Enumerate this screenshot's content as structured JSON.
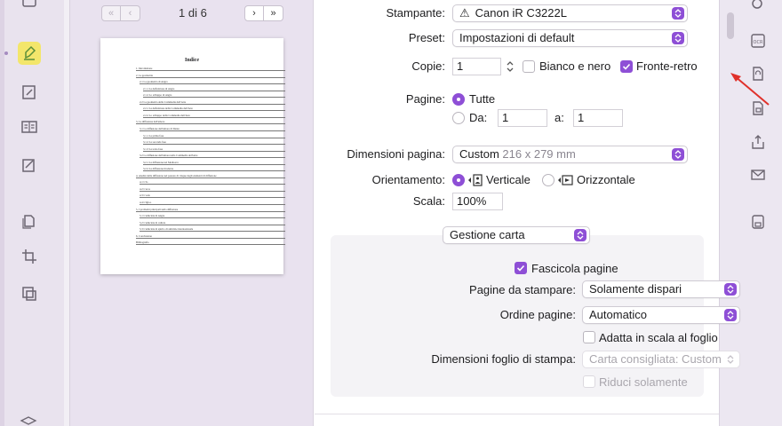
{
  "preview": {
    "page_counter": "1 di 6",
    "thumbnail": {
      "title": "Indice",
      "lines": [
        "1. Introduzione",
        "2. La geometria",
        "2.1 La geometria di Angra",
        "2.1.1 La definizione di Angra",
        "2.1.2 Lo sviluppo di Angra",
        "2.2 La geometria della Commedia dell'Arte",
        "2.2.1 La definizione della Commedia dell'Arte",
        "2.2.2 Lo sviluppo della Commedia dell'Arte",
        "3. La diffusione dell'amore",
        "3.1 La diffusione dell'amore di Dante",
        "3.1.1 La prima fase",
        "3.1.2 La seconda fase",
        "3.1.3 La terza fase",
        "3.2 La diffusione dell'amore nella Commedia dell'Arte",
        "3.2.1 La diffusione nel Medioevo",
        "3.2.2 La diffusione moderna",
        "4. Analisi della diffusione nel passato di cinque degli elementi di diffusione",
        "4.1 L'Io",
        "4.2 L'eros",
        "4.3 L'ozio",
        "4.4 L'Igloo",
        "5. I problemi principali nella diffusione",
        "5.1 L'amicizia di Angra",
        "5.2 L'amicizia di cultura",
        "5.3 L'amicizia di spirito di amicizie internazionale",
        "6. Conclusione",
        "Bibliografia"
      ]
    }
  },
  "settings": {
    "printer": {
      "label": "Stampante:",
      "value": "Canon iR C3222L",
      "icon": "warning-icon"
    },
    "preset": {
      "label": "Preset:",
      "value": "Impostazioni di default"
    },
    "copies": {
      "label": "Copie:",
      "value": "1",
      "bw_label": "Bianco e nero",
      "bw_checked": false,
      "duplex_label": "Fronte-retro",
      "duplex_checked": true
    },
    "pages": {
      "label": "Pagine:",
      "all_label": "Tutte",
      "all_selected": true,
      "from_label": "Da:",
      "from_value": "1",
      "to_label": "a:",
      "to_value": "1"
    },
    "paper_size": {
      "label": "Dimensioni pagina:",
      "value": "Custom",
      "detail": "216 x 279 mm"
    },
    "orientation": {
      "label": "Orientamento:",
      "portrait_label": "Verticale",
      "portrait_selected": true,
      "landscape_label": "Orizzontale"
    },
    "scale": {
      "label": "Scala:",
      "value": "100%"
    },
    "section": {
      "value": "Gestione carta",
      "collate": {
        "label": "Fascicola pagine",
        "checked": true
      },
      "pages_to_print": {
        "label": "Pagine da stampare:",
        "value": "Solamente dispari"
      },
      "page_order": {
        "label": "Ordine pagine:",
        "value": "Automatico"
      },
      "fit_to_paper": {
        "label": "Adatta in scala al foglio",
        "checked": false
      },
      "paper_size": {
        "label": "Dimensioni foglio di stampa:",
        "value": "Carta consigliata: Custom",
        "disabled": true
      },
      "reduce_only": {
        "label": "Riduci solamente",
        "disabled": true
      }
    }
  },
  "colors": {
    "accent": "#8e4fd6",
    "annotation_arrow": "#e0312b"
  }
}
